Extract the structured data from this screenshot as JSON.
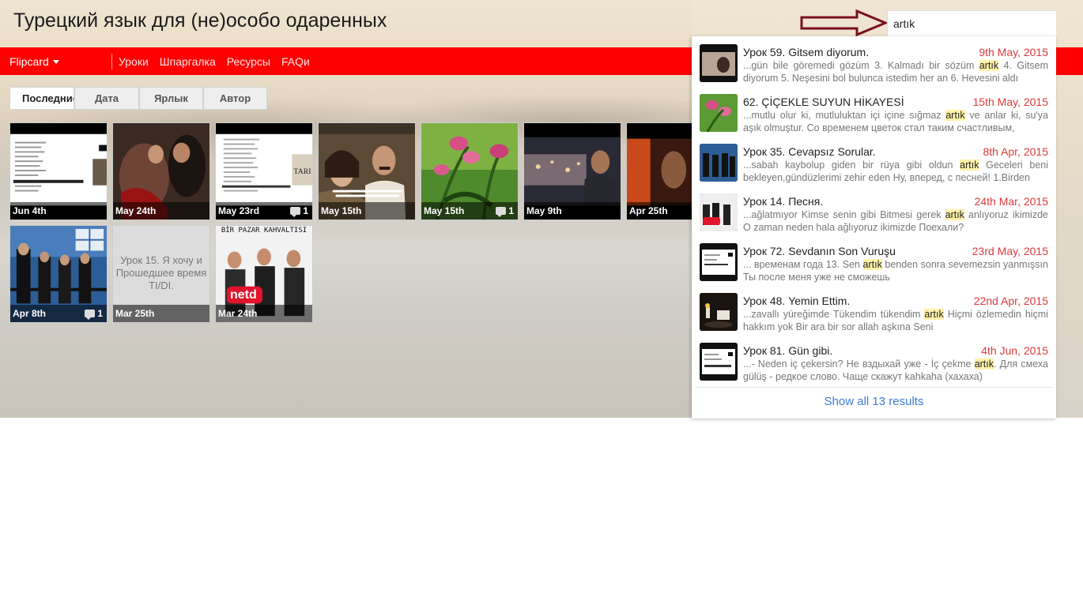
{
  "blog": {
    "title": "Турецкий язык для (не)особо одаренных"
  },
  "search": {
    "query": "artık"
  },
  "nav": {
    "brand": "Flipcard",
    "links": [
      "Уроки",
      "Шпаргалка",
      "Ресурсы",
      "FAQи"
    ]
  },
  "tabs": [
    "Последние",
    "Дата",
    "Ярлык",
    "Автор"
  ],
  "thumbnails": [
    {
      "date": "Jun 4th",
      "comments": ""
    },
    {
      "date": "May 24th",
      "comments": ""
    },
    {
      "date": "May 23rd",
      "comments": "1"
    },
    {
      "date": "May 15th",
      "comments": ""
    },
    {
      "date": "May 15th",
      "comments": "1"
    },
    {
      "date": "May 9th",
      "comments": ""
    },
    {
      "date": "Apr 25th",
      "comments": ""
    },
    {
      "date": "Apr 8th",
      "comments": "1"
    },
    {
      "date": "Mar 25th",
      "comments": "",
      "text": "Урок 15. Я хочу и Прошедшее время TI/DI."
    },
    {
      "date": "Mar 24th",
      "comments": "",
      "banner": "BİR PAZAR KAHVALTISI",
      "logo": "netd"
    }
  ],
  "results": [
    {
      "title": "Урок 59. Gitsem diyorum.",
      "date": "9th May, 2015",
      "pre": "...gün bile göremedi gözüm  3. Kalmadı bir sözüm ",
      "hl": "artık",
      "post": "  4. Gitsem diyorum  5. Neşesini bol bulunca istedim her an  6. Hevesini aldı"
    },
    {
      "title": "62. ÇİÇEKLE SUYUN HİKAYESİ",
      "date": "15th May, 2015",
      "pre": "...mutlu olur ki, mutluluktan içi içine sığmaz ",
      "hl": "artık",
      "post": " ve anlar ki, su'ya aşık olmuştur. Со временем цветок стал таким счастливым,"
    },
    {
      "title": "Урок 35. Cevapsız Sorular.",
      "date": "8th Apr, 2015",
      "pre": "...sabah kaybolup giden bir rüya gibi oldun ",
      "hl": "artık",
      "post": " Geceleri beni bekleyen,gündüzlerimi zehir eden Ну, вперед, с песней! 1.Birden"
    },
    {
      "title": "Урок 14. Песня.",
      "date": "24th Mar, 2015",
      "pre": "...ağlatmıyor Kimse senin gibi Bitmesi gerek ",
      "hl": "artık",
      "post": " anlıyoruz ikimizde O zaman neden hala ağlıyoruz ikimizde Поехали?"
    },
    {
      "title": "Урок 72. Sevdanın Son Vuruşu",
      "date": "23rd May, 2015",
      "pre": "...                     временам года 13. Sen ",
      "hl": "artık",
      "post": " benden sonra sevemezsin yanmışsın          Ты после меня уже не сможешь"
    },
    {
      "title": "Урок 48. Yemin Ettim.",
      "date": "22nd Apr, 2015",
      "pre": "...zavallı yüreğimde Tükendim tükendim ",
      "hl": "artık",
      "post": " Hiçmi özlemedin hiçmi hakkım yok Bir ara bir sor allah aşkına Seni"
    },
    {
      "title": "Урок 81. Gün gibi.",
      "date": "4th Jun, 2015",
      "pre": "...- Neden iç çekersin? Не вздыхай уже - İç çekme ",
      "hl": "artık",
      "post": ". Для смеха gülüş - редкое слово. Чаще скажут kahkaha (хахаха)"
    }
  ],
  "show_all": "Show all 13 results"
}
